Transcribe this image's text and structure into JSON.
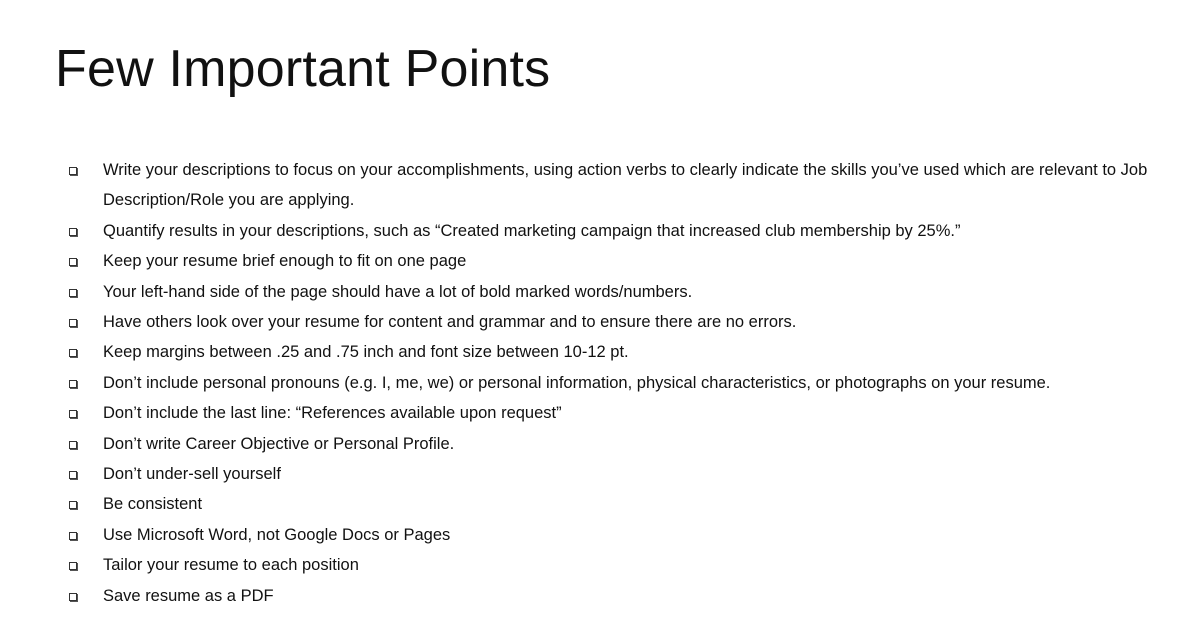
{
  "slide": {
    "title": "Few Important Points",
    "bullets": [
      "Write your descriptions to focus on your accomplishments, using action verbs to clearly indicate the skills you’ve used which are relevant to Job Description/Role you are applying.",
      "Quantify results in your descriptions, such as “Created marketing campaign that increased club membership by 25%.”",
      "Keep your resume brief enough to fit on one page",
      "Your left-hand side of the page should have a lot of bold marked words/numbers.",
      "Have others look over your resume for content and grammar and to ensure there are no errors.",
      "Keep margins between .25 and .75 inch and font size between 10-12 pt.",
      "Don’t include personal pronouns (e.g. I, me, we) or personal information, physical characteristics, or photographs on your resume.",
      "Don’t include the last line: “References available upon request”",
      "Don’t write Career Objective or Personal Profile.",
      "Don’t under-sell yourself",
      "Be consistent",
      "Use Microsoft Word, not Google Docs or Pages",
      "Tailor your resume to each position",
      "Save resume as a PDF"
    ],
    "bullet_icon": "hollow-square-bullet-icon",
    "colors": {
      "background": "#ffffff",
      "text": "#111111"
    }
  }
}
